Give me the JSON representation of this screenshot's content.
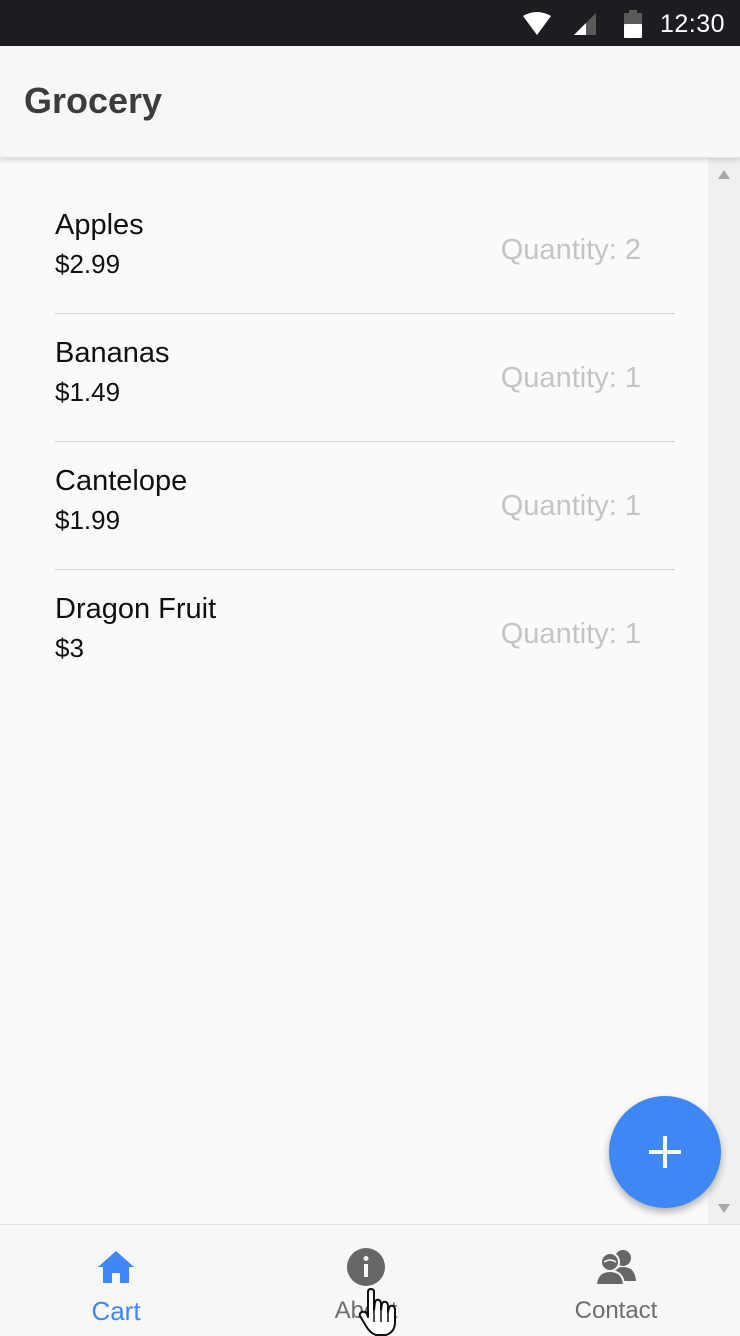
{
  "status_bar": {
    "time": "12:30",
    "icons": [
      "wifi-icon",
      "signal-icon",
      "battery-icon"
    ]
  },
  "app_bar": {
    "title": "Grocery"
  },
  "cart": {
    "items": [
      {
        "name": "Apples",
        "price": "$2.99",
        "quantity": "Quantity: 2"
      },
      {
        "name": "Bananas",
        "price": "$1.49",
        "quantity": "Quantity: 1"
      },
      {
        "name": "Cantelope",
        "price": "$1.99",
        "quantity": "Quantity: 1"
      },
      {
        "name": "Dragon Fruit",
        "price": "$3",
        "quantity": "Quantity: 1"
      }
    ]
  },
  "fab": {
    "icon": "plus-icon"
  },
  "bottom_nav": {
    "tabs": [
      {
        "label": "Cart",
        "icon": "home-icon",
        "active": true
      },
      {
        "label": "About",
        "icon": "info-icon",
        "active": false
      },
      {
        "label": "Contact",
        "icon": "people-icon",
        "active": false
      }
    ]
  },
  "colors": {
    "accent": "#3f87f5",
    "status_bar": "#1c1d20",
    "app_bar": "#f7f7f7",
    "quantity_text": "#c4c4c4",
    "inactive_tab": "#6e6e6e"
  }
}
